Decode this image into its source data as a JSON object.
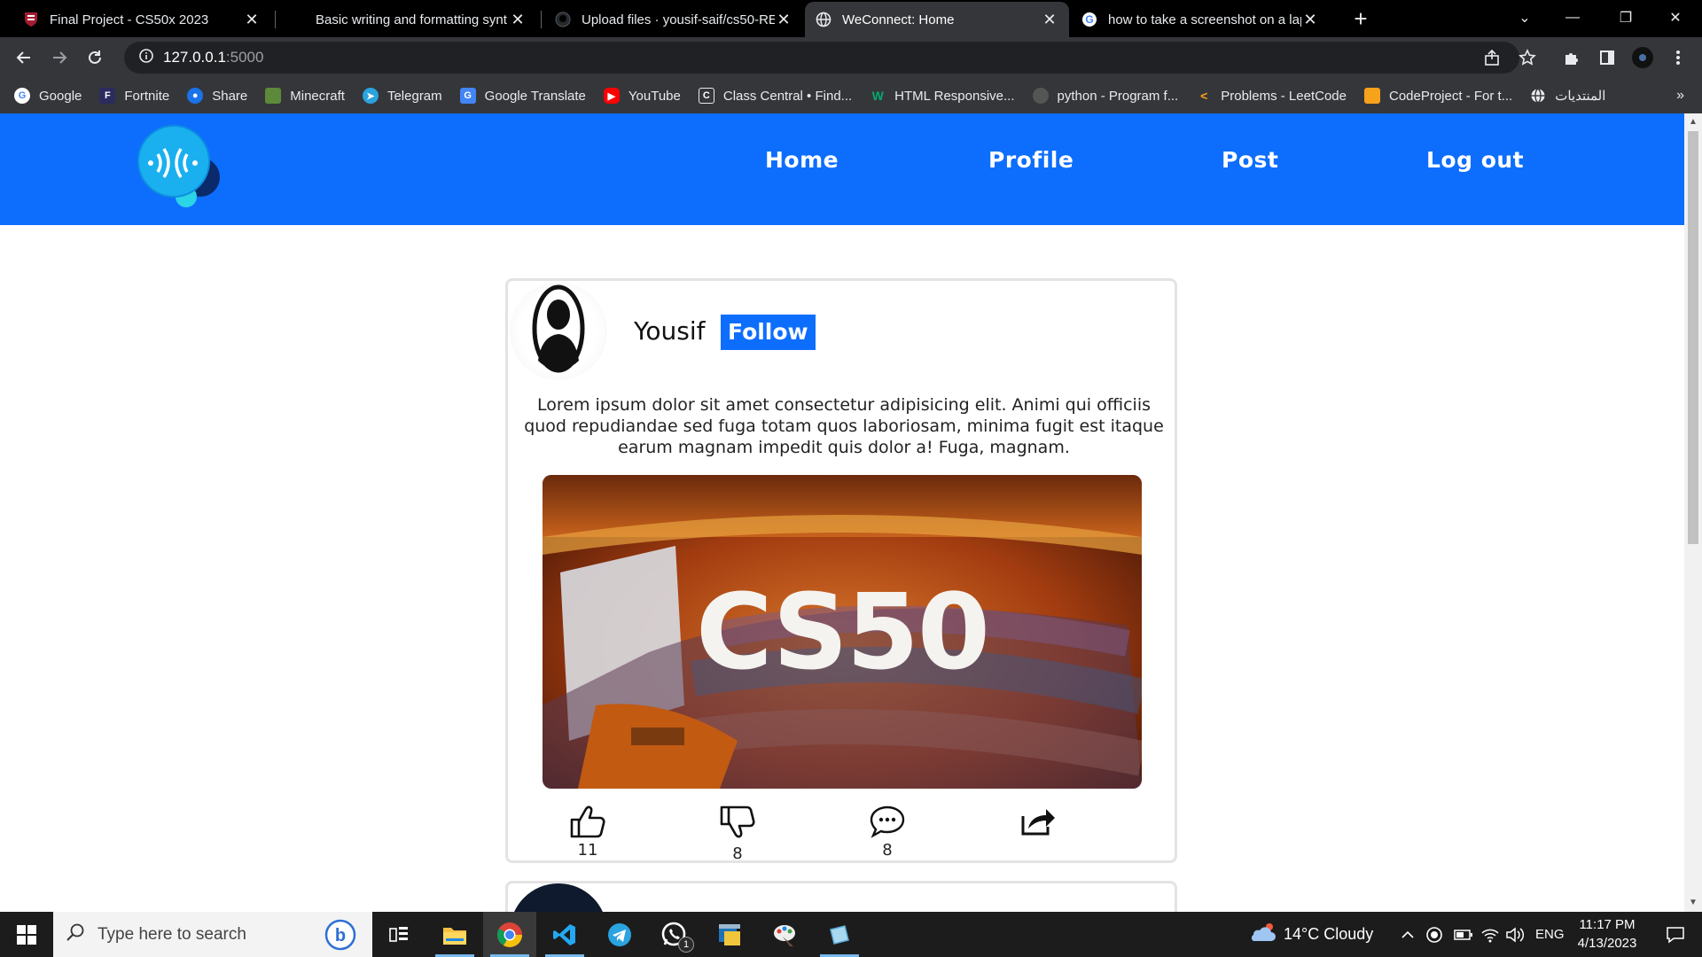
{
  "browser": {
    "tabs": [
      {
        "title": "Final Project - CS50x 2023",
        "icon": "harvard-shield-icon",
        "active": false
      },
      {
        "title": "Basic writing and formatting synt",
        "icon": "github-icon",
        "active": false
      },
      {
        "title": "Upload files · yousif-saif/cs50-RE",
        "icon": "github-icon",
        "active": false
      },
      {
        "title": "WeConnect: Home",
        "icon": "globe-icon",
        "active": true
      },
      {
        "title": "how to take a screenshot on a lap",
        "icon": "google-icon",
        "active": false
      }
    ],
    "address": {
      "host": "127.0.0.1",
      "port": ":5000"
    },
    "bookmarks": [
      {
        "label": "Google",
        "icon": "google-icon",
        "color": "#ffffff"
      },
      {
        "label": "Fortnite",
        "icon": "fortnite-icon",
        "color": "#2b2b5e"
      },
      {
        "label": "Share",
        "icon": "share-people-icon",
        "color": "#1a73e8"
      },
      {
        "label": "Minecraft",
        "icon": "minecraft-icon",
        "color": "#5d8a3a"
      },
      {
        "label": "Telegram",
        "icon": "telegram-icon",
        "color": "#2aa3df"
      },
      {
        "label": "Google Translate",
        "icon": "translate-icon",
        "color": "#4285f4"
      },
      {
        "label": "YouTube",
        "icon": "youtube-icon",
        "color": "#ff0000"
      },
      {
        "label": "Class Central • Find...",
        "icon": "classcentral-icon",
        "color": "#444444"
      },
      {
        "label": "HTML Responsive...",
        "icon": "w3schools-icon",
        "color": "#04aa6d"
      },
      {
        "label": "python - Program f...",
        "icon": "stackoverflow-icon",
        "color": "#555555"
      },
      {
        "label": "Problems - LeetCode",
        "icon": "leetcode-icon",
        "color": "#ffa116"
      },
      {
        "label": "CodeProject - For t...",
        "icon": "codeproject-icon",
        "color": "#f7a21b"
      },
      {
        "label": "المنتديات",
        "icon": "globe-icon",
        "color": "#ffffff"
      }
    ]
  },
  "site": {
    "brand_color": "#0d6efd",
    "nav": {
      "home": "Home",
      "profile": "Profile",
      "post": "Post",
      "logout": "Log out"
    }
  },
  "post": {
    "username": "Yousif",
    "follow_label": "Follow",
    "text": "Lorem ipsum dolor sit amet consectetur adipisicing elit. Animi qui officiis quod repudiandae sed fuga totam quos laboriosam, minima fugit est itaque earum magnam impedit quis dolor a! Fuga, magnam.",
    "image_caption": "CS50",
    "likes": "11",
    "dislikes": "8",
    "comments": "8"
  },
  "taskbar": {
    "search_placeholder": "Type here to search",
    "weather": "14°C  Cloudy",
    "language": "ENG",
    "time": "11:17 PM",
    "date": "4/13/2023",
    "whatsapp_badge": "1"
  }
}
